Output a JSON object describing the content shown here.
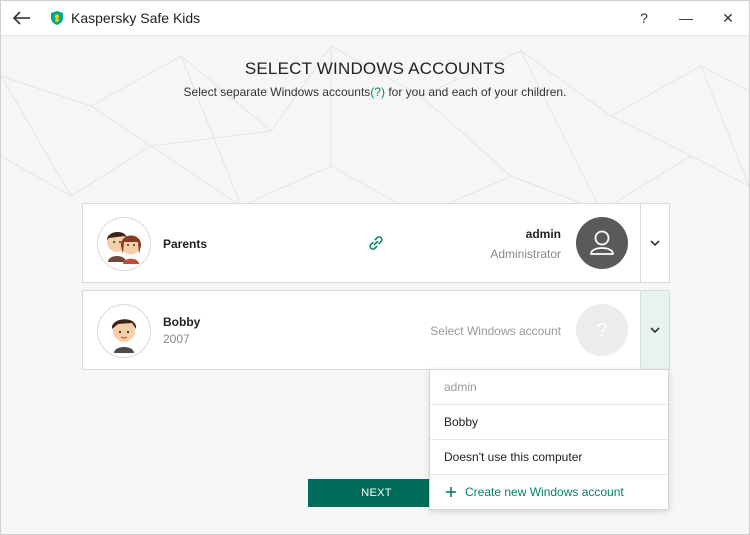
{
  "window": {
    "title": "Kaspersky Safe Kids",
    "help": "?",
    "minimize": "—",
    "close": "✕"
  },
  "page": {
    "heading": "SELECT WINDOWS ACCOUNTS",
    "subheading_before": "Select separate Windows accounts",
    "help_link": "(?)",
    "subheading_after": " for you and each of your children."
  },
  "cards": {
    "parents": {
      "name": "Parents",
      "account_name": "admin",
      "account_role": "Administrator"
    },
    "child": {
      "name": "Bobby",
      "year": "2007",
      "account_placeholder": "Select Windows account",
      "account_avatar_mark": "?"
    }
  },
  "dropdown": {
    "items": [
      {
        "label": "admin"
      },
      {
        "label": "Bobby"
      },
      {
        "label": "Doesn't use this computer"
      }
    ],
    "create_label": "Create new Windows account"
  },
  "next_label": "NEXT",
  "colors": {
    "accent": "#006d5b",
    "link": "#008a6b",
    "admin_avatar": "#5a5a5a"
  }
}
